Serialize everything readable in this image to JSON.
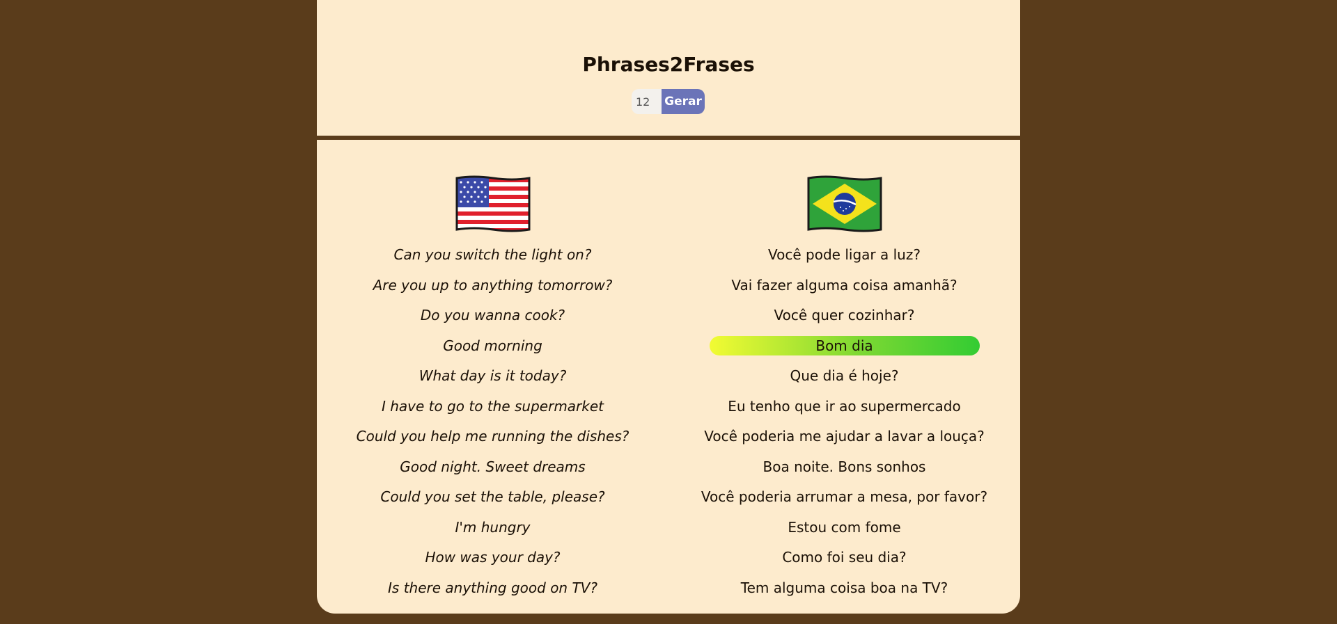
{
  "app": {
    "title": "Phrases2Frases"
  },
  "controls": {
    "count_value": "12",
    "generate_label": "Gerar"
  },
  "flags": {
    "english": "us-flag-icon",
    "portuguese": "brazil-flag-icon"
  },
  "colors": {
    "background": "#5a3c1b",
    "card": "#fdebcd",
    "button": "#6b74b8",
    "highlight_start": "#f2fb33",
    "highlight_end": "#33cc33"
  },
  "phrases": {
    "english": [
      "Can you switch the light on?",
      "Are you up to anything tomorrow?",
      "Do you wanna cook?",
      "Good morning",
      "What day is it today?",
      "I have to go to the supermarket",
      "Could you help me running the dishes?",
      "Good night. Sweet dreams",
      "Could you set the table, please?",
      "I'm hungry",
      "How was your day?",
      "Is there anything good on TV?"
    ],
    "portuguese": [
      "Você pode ligar a luz?",
      "Vai fazer alguma coisa amanhã?",
      "Você quer cozinhar?",
      "Bom dia",
      "Que dia é hoje?",
      "Eu tenho que ir ao supermercado",
      "Você poderia me ajudar a lavar a louça?",
      "Boa noite. Bons sonhos",
      "Você poderia arrumar a mesa, por favor?",
      "Estou com fome",
      "Como foi seu dia?",
      "Tem alguma coisa boa na TV?"
    ],
    "highlighted_index": 3
  }
}
